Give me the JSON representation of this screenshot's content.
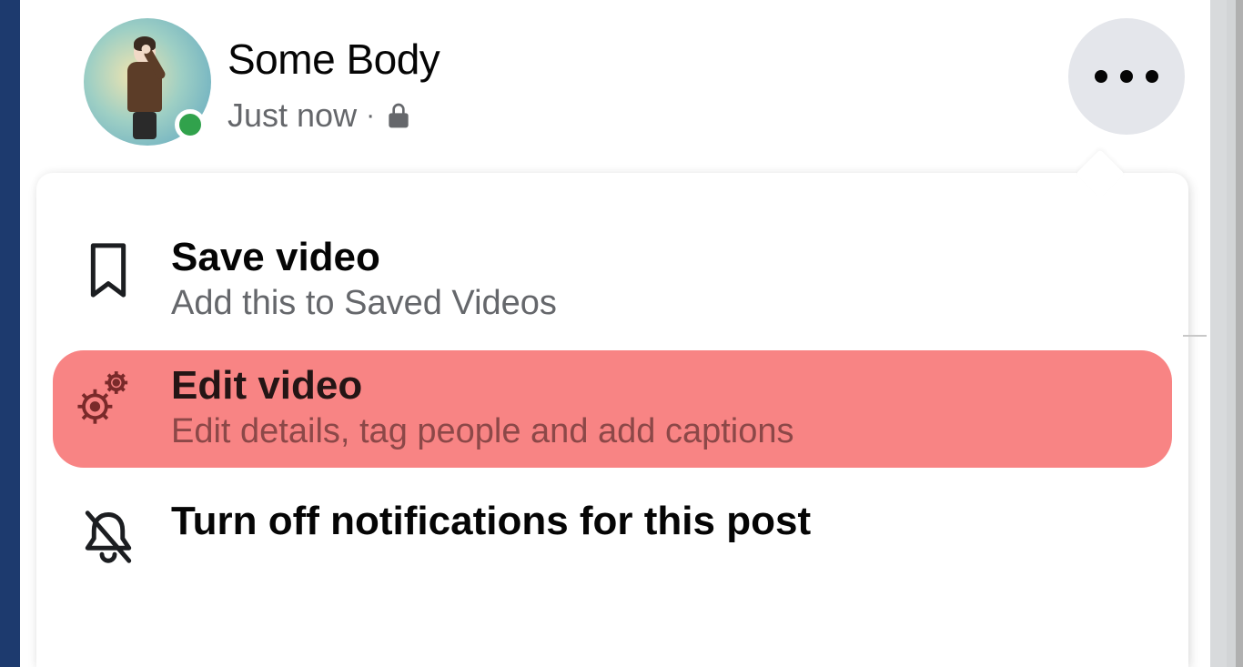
{
  "post": {
    "author_name": "Some Body",
    "timestamp": "Just now",
    "privacy": "Only me"
  },
  "menu": {
    "items": [
      {
        "title": "Save video",
        "subtitle": "Add this to Saved Videos"
      },
      {
        "title": "Edit video",
        "subtitle": "Edit details, tag people and add captions"
      },
      {
        "title": "Turn off notifications for this post",
        "subtitle": ""
      }
    ]
  }
}
